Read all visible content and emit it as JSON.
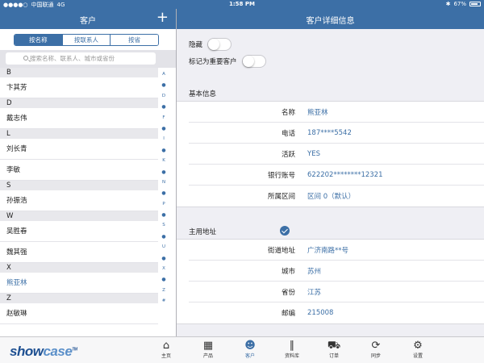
{
  "status": {
    "carrier": "中国联通",
    "network": "4G",
    "time": "1:58 PM",
    "battery": "67%",
    "bluetooth": "✱"
  },
  "left": {
    "title": "客户",
    "add_icon": "plus-icon",
    "segments": [
      "按名称",
      "按联系人",
      "按省"
    ],
    "search_placeholder": "搜索名称、联系人、城市或省份",
    "list": [
      {
        "type": "header",
        "text": "B"
      },
      {
        "type": "row",
        "text": "卞其芳"
      },
      {
        "type": "header",
        "text": "D"
      },
      {
        "type": "row",
        "text": "戴志伟"
      },
      {
        "type": "header",
        "text": "L"
      },
      {
        "type": "row",
        "text": "刘长青"
      },
      {
        "type": "row",
        "text": "李敏"
      },
      {
        "type": "header",
        "text": "S"
      },
      {
        "type": "row",
        "text": "孙振浩"
      },
      {
        "type": "header",
        "text": "W"
      },
      {
        "type": "row",
        "text": "吴胜春"
      },
      {
        "type": "row",
        "text": "魏其强"
      },
      {
        "type": "header",
        "text": "X"
      },
      {
        "type": "row",
        "text": "熊亚林",
        "selected": true
      },
      {
        "type": "header",
        "text": "Z"
      },
      {
        "type": "row",
        "text": "赵敏琳"
      }
    ],
    "index": [
      "A",
      "●",
      "D",
      "●",
      "F",
      "●",
      "I",
      "●",
      "K",
      "●",
      "N",
      "●",
      "P",
      "●",
      "S",
      "●",
      "U",
      "●",
      "X",
      "●",
      "Z",
      "#"
    ]
  },
  "right": {
    "title": "客户详细信息",
    "toggles": [
      {
        "label": "隐藏"
      },
      {
        "label": "标记为重要客户"
      }
    ],
    "basic_section": "基本信息",
    "basic_rows": [
      {
        "label": "名称",
        "value": "熊亚林"
      },
      {
        "label": "电话",
        "value": "187****5542"
      },
      {
        "label": "活跃",
        "value": "YES"
      },
      {
        "label": "银行账号",
        "value": "622202********12321"
      },
      {
        "label": "所属区间",
        "value": "区间 0（默认）"
      }
    ],
    "address_section": "主用地址",
    "address_rows": [
      {
        "label": "街道地址",
        "value": "广济南路**号"
      },
      {
        "label": "城市",
        "value": "苏州"
      },
      {
        "label": "省份",
        "value": "江苏"
      },
      {
        "label": "邮编",
        "value": "215008"
      }
    ]
  },
  "tabbar": {
    "logo_main": "show",
    "logo_accent": "case",
    "logo_tm": "TM",
    "tabs": [
      {
        "label": "主页",
        "icon": "home-icon",
        "glyph": "⌂"
      },
      {
        "label": "产品",
        "icon": "grid-icon",
        "glyph": "▦"
      },
      {
        "label": "客户",
        "icon": "customers-icon",
        "glyph": "☻",
        "active": true
      },
      {
        "label": "资料库",
        "icon": "library-icon",
        "glyph": "∥"
      },
      {
        "label": "订单",
        "icon": "cart-icon",
        "glyph": "⛟"
      },
      {
        "label": "同步",
        "icon": "sync-icon",
        "glyph": "⟳"
      },
      {
        "label": "设置",
        "icon": "gear-icon",
        "glyph": "⚙"
      }
    ]
  },
  "colors": {
    "accent": "#3c6fa6",
    "background": "#efeff4"
  }
}
